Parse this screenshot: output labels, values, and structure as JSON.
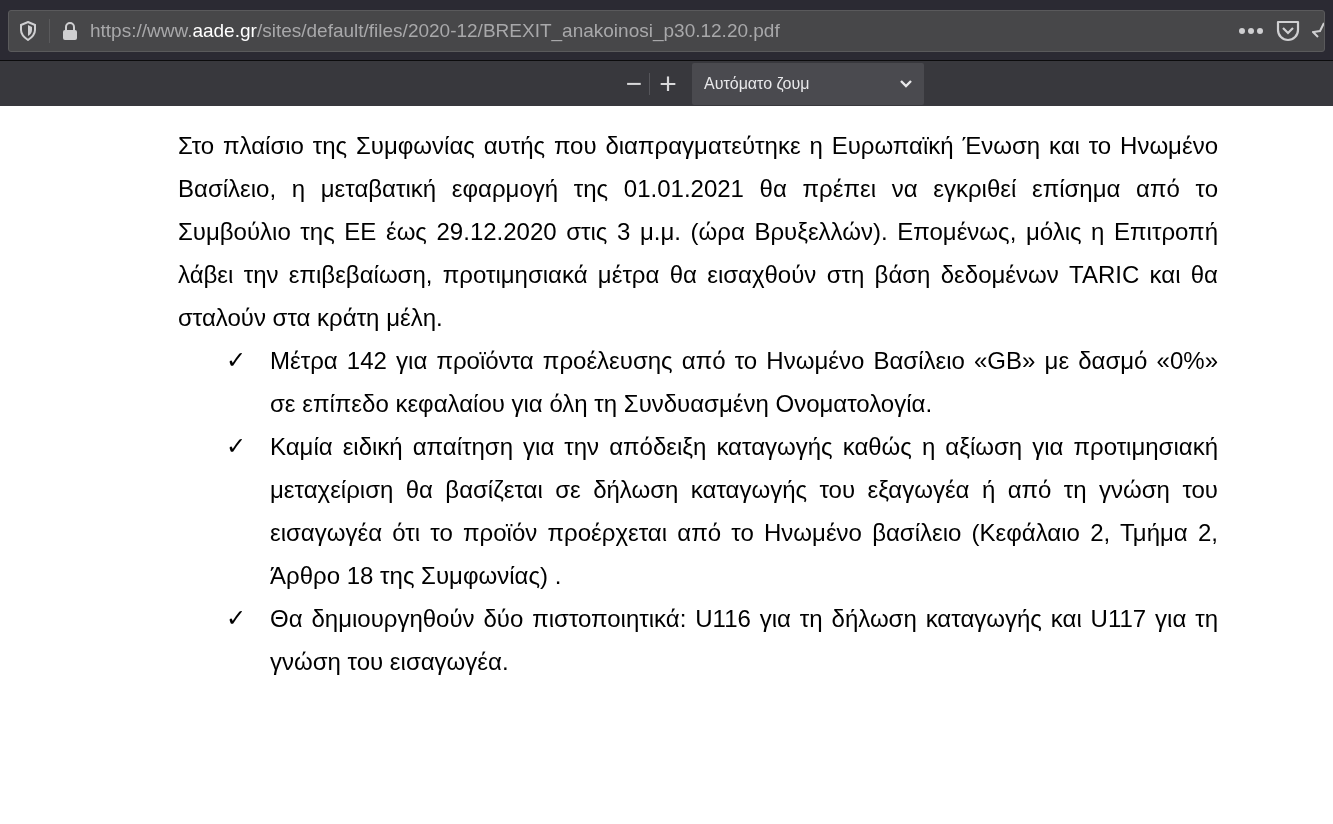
{
  "address_bar": {
    "url_prefix": "https://www.",
    "url_domain": "aade.gr",
    "url_path": "/sites/default/files/2020-12/BREXIT_anakoinosi_p30.12.20.pdf"
  },
  "pdf_toolbar": {
    "zoom_out": "−",
    "zoom_in": "+",
    "zoom_select": "Αυτόματο ζουμ"
  },
  "document": {
    "paragraph": "Στο πλαίσιο της Συμφωνίας αυτής που διαπραγματεύτηκε η Ευρωπαϊκή Ένωση και το Ηνωμένο Βασίλειο, η μεταβατική εφαρμογή της 01.01.2021 θα πρέπει να εγκριθεί επίσημα από το Συμβούλιο της ΕΕ έως 29.12.2020 στις 3 μ.μ. (ώρα Βρυξελλών). Επομένως, μόλις η Επιτροπή λάβει την επιβεβαίωση, προτιμησιακά μέτρα θα εισαχθούν στη βάση δεδομένων TARIC και θα σταλούν στα κράτη μέλη.",
    "bullets": [
      {
        "mark": "✓",
        "text": "Μέτρα 142 για προϊόντα προέλευσης  από το Ηνωμένο Βασίλειο «GB» με δασμό «0%» σε επίπεδο κεφαλαίου για όλη τη Συνδυασμένη Ονοματολογία."
      },
      {
        "mark": "✓",
        "text": "Καμία ειδική απαίτηση για την απόδειξη καταγωγής καθώς η αξίωση για προτιμησιακή μεταχείριση θα βασίζεται σε δήλωση καταγωγής του εξαγωγέα ή από τη γνώση του εισαγωγέα ότι το προϊόν προέρχεται από το Ηνωμένο βασίλειο (Κεφάλαιο 2, Τμήμα 2, Άρθρο 18 της Συμφωνίας) ."
      },
      {
        "mark": "✓",
        "text": "Θα δημιουργηθούν δύο πιστοποιητικά: U116 για  τη  δήλωση καταγωγής και   U117 για  τη γνώση του εισαγωγέα."
      }
    ]
  }
}
